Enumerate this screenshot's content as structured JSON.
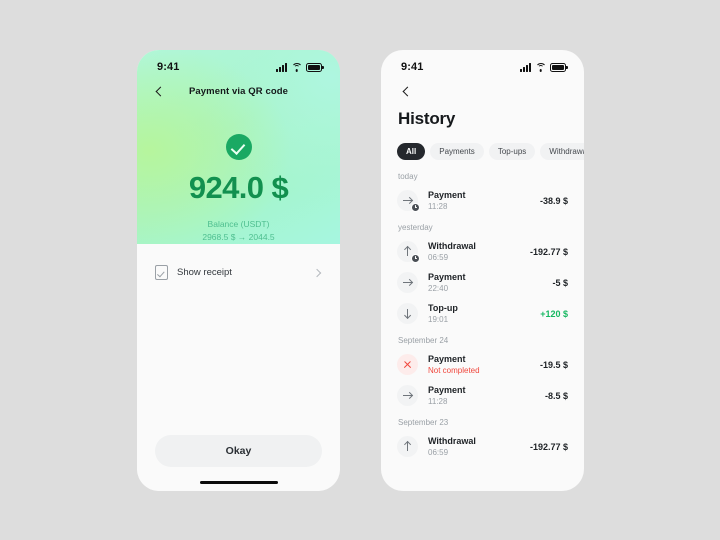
{
  "background_color": "#dddddd",
  "payment_screen": {
    "status_bar": {
      "time": "9:41",
      "icons": [
        "signal-icon",
        "wifi-icon",
        "battery-icon"
      ]
    },
    "nav": {
      "back_label": "back-chevron",
      "title": "Payment via QR code"
    },
    "success": {
      "status_icon": "check-circle-icon",
      "amount": "924.0 $",
      "balance_label": "Balance (USDT)",
      "balance_change": "2968.5 $ → 2044.5",
      "amount_color": "#12904f"
    },
    "sheet": {
      "receipt_icon": "receipt-check-icon",
      "receipt_label": "Show receipt",
      "chevron_icon": "chevron-right-icon",
      "primary_button": "Okay"
    }
  },
  "history_screen": {
    "status_bar": {
      "time": "9:41",
      "icons": [
        "signal-icon",
        "wifi-icon",
        "battery-icon"
      ]
    },
    "nav": {
      "back_label": "back-chevron"
    },
    "title": "History",
    "filters": [
      {
        "label": "All",
        "active": true
      },
      {
        "label": "Payments",
        "active": false
      },
      {
        "label": "Top-ups",
        "active": false
      },
      {
        "label": "Withdrawal",
        "active": false
      }
    ],
    "groups": [
      {
        "label": "today",
        "transactions": [
          {
            "title": "Payment",
            "sub": "11:28",
            "amount": "-38.9 $",
            "icon": "arrow-right-icon",
            "direction": "right",
            "pending": true,
            "failed": false,
            "positive": false
          }
        ]
      },
      {
        "label": "yesterday",
        "transactions": [
          {
            "title": "Withdrawal",
            "sub": "06:59",
            "amount": "-192.77 $",
            "icon": "arrow-up-icon",
            "direction": "up",
            "pending": true,
            "failed": false,
            "positive": false
          },
          {
            "title": "Payment",
            "sub": "22:40",
            "amount": "-5 $",
            "icon": "arrow-right-icon",
            "direction": "right",
            "pending": false,
            "failed": false,
            "positive": false
          },
          {
            "title": "Top-up",
            "sub": "19:01",
            "amount": "+120 $",
            "icon": "arrow-down-icon",
            "direction": "down",
            "pending": false,
            "failed": false,
            "positive": true
          }
        ]
      },
      {
        "label": "September 24",
        "transactions": [
          {
            "title": "Payment",
            "sub": "Not completed",
            "amount": "-19.5 $",
            "icon": "x-mark-icon",
            "direction": "fail",
            "pending": false,
            "failed": true,
            "positive": false
          },
          {
            "title": "Payment",
            "sub": "11:28",
            "amount": "-8.5 $",
            "icon": "arrow-right-icon",
            "direction": "right",
            "pending": false,
            "failed": false,
            "positive": false
          }
        ]
      },
      {
        "label": "September 23",
        "transactions": [
          {
            "title": "Withdrawal",
            "sub": "06:59",
            "amount": "-192.77 $",
            "icon": "arrow-up-icon",
            "direction": "up",
            "pending": false,
            "failed": false,
            "positive": false
          }
        ]
      }
    ]
  }
}
